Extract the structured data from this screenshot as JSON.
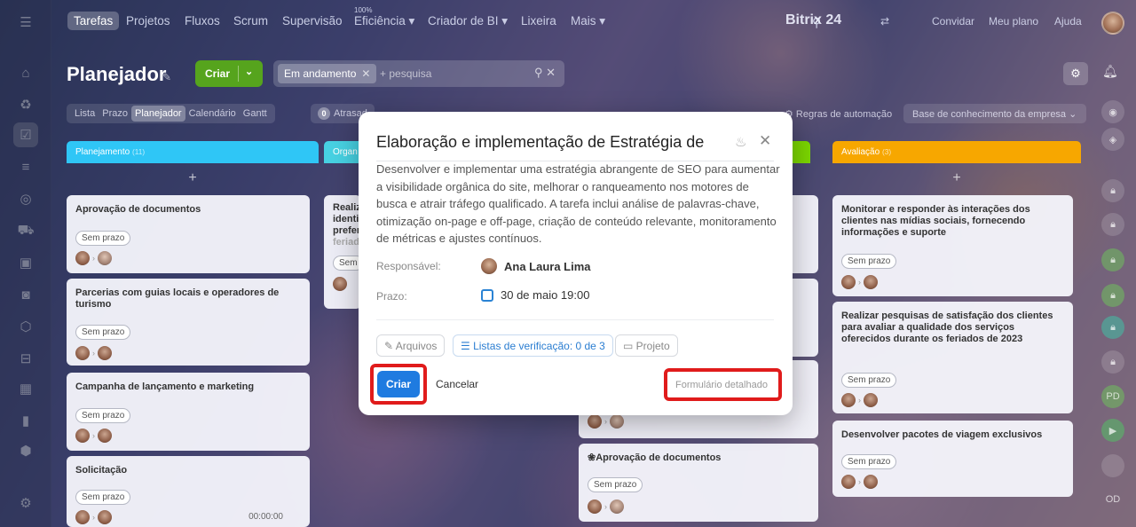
{
  "topbar": {
    "tabs": [
      "Tarefas",
      "Projetos",
      "Fluxos",
      "Scrum",
      "Supervisão",
      "Eficiência",
      "Criador de BI",
      "Lixeira",
      "Mais"
    ],
    "efficiency_badge": "100%",
    "logo": "Bitrix 24",
    "invite": "Convidar",
    "plan": "Meu plano",
    "help": "Ajuda"
  },
  "header": {
    "title": "Planejador",
    "create_label": "Criar",
    "filter_chip": "Em andamento",
    "search_placeholder": "+ pesquisa",
    "views": [
      "Lista",
      "Prazo",
      "Planejador",
      "Calendário",
      "Gantt"
    ],
    "overdue_count": "0",
    "overdue_label": "Atrasad",
    "automation_label": "Regras de automação",
    "knowledge_base": "Base de conhecimento da empresa"
  },
  "columns": [
    {
      "name": "Planejamento",
      "count": "(11)",
      "color": "#2fc6f6"
    },
    {
      "name": "Organ",
      "count": "",
      "color": "#47d1e2"
    },
    {
      "name": "Avaliação",
      "count": "(3)",
      "color": "#f7a700"
    }
  ],
  "cards_col1": [
    {
      "title": "Aprovação de documentos",
      "deadline": "Sem prazo"
    },
    {
      "title": "Parcerias com guias locais e operadores de turismo",
      "deadline": "Sem prazo"
    },
    {
      "title": "Campanha de lançamento e marketing",
      "deadline": "Sem prazo"
    },
    {
      "title": "Solicitação",
      "deadline": "Sem prazo",
      "timer": "00:00:00"
    }
  ],
  "cards_col2": [
    {
      "title_lines": [
        "Realiz",
        "identi",
        "prefer",
        "feriad"
      ],
      "deadline": "Sem"
    }
  ],
  "cards_col3": [
    {
      "title": "Aprovação de documentos",
      "deadline": "Sem prazo"
    }
  ],
  "cards_col4": [
    {
      "title": "Monitorar e responder às interações dos clientes nas mídias sociais, fornecendo informações e suporte",
      "deadline": "Sem prazo"
    },
    {
      "title": "Realizar pesquisas de satisfação dos clientes para avaliar a qualidade dos serviços oferecidos durante os feriados de 2023",
      "deadline": "Sem prazo"
    },
    {
      "title": "Desenvolver pacotes de viagem exclusivos",
      "deadline": "Sem prazo"
    }
  ],
  "modal": {
    "title": "Elaboração e implementação de Estratégia de",
    "description": "Desenvolver e implementar uma estratégia abrangente de SEO para aumentar a visibilidade orgânica do site, melhorar o ranqueamento nos motores de busca e atrair tráfego qualificado. A tarefa inclui análise de palavras-chave, otimização on-page e off-page, criação de conteúdo relevante, monitoramento de métricas e ajustes contínuos.",
    "responsible_label": "Responsável:",
    "responsible_value": "Ana Laura Lima",
    "deadline_label": "Prazo:",
    "deadline_value": "30 de maio 19:00",
    "files_label": "Arquivos",
    "checklists_label": "Listas de verificação: 0 de 3",
    "project_label": "Projeto",
    "create_label": "Criar",
    "cancel_label": "Cancelar",
    "detailed_form_label": "Formulário detalhado"
  },
  "rail_footer": "OD",
  "rail_badge": "PD"
}
